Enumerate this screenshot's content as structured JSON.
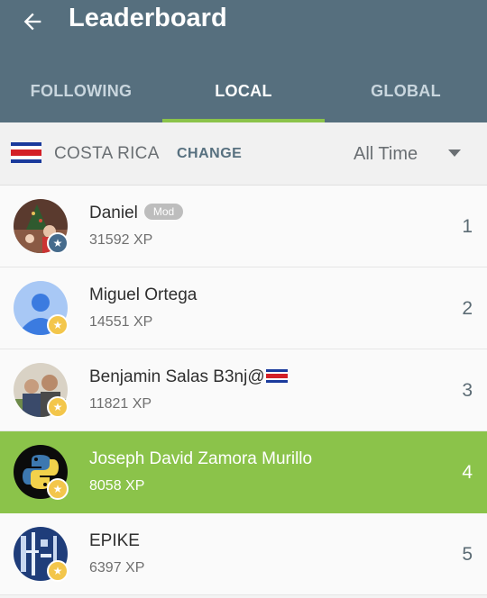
{
  "header": {
    "title": "Leaderboard",
    "back_icon": "arrow-left-icon"
  },
  "tabs": [
    {
      "label": "FOLLOWING",
      "active": false
    },
    {
      "label": "LOCAL",
      "active": true
    },
    {
      "label": "GLOBAL",
      "active": false
    }
  ],
  "filter": {
    "country": "COSTA RICA",
    "change_label": "CHANGE",
    "period": "All Time",
    "flag_icon": "costa-rica-flag-icon",
    "dropdown_icon": "caret-down-icon"
  },
  "entries": [
    {
      "name": "Daniel",
      "tag": "Mod",
      "xp": "31592 XP",
      "rank": "1",
      "badge": "mod-badge-icon"
    },
    {
      "name": "Miguel Ortega",
      "xp": "14551 XP",
      "rank": "2",
      "badge": "star-badge-icon"
    },
    {
      "name": "Benjamin Salas B3nj@",
      "name_suffix_icon": "costa-rica-flag-icon",
      "xp": "11821 XP",
      "rank": "3",
      "badge": "star-badge-icon"
    },
    {
      "name": "Joseph David Zamora Murillo",
      "xp": "8058 XP",
      "rank": "4",
      "badge": "star-badge-icon",
      "highlighted": true
    },
    {
      "name": "EPIKE",
      "xp": "6397 XP",
      "rank": "5",
      "badge": "star-badge-icon"
    }
  ],
  "colors": {
    "appbar": "#566f7e",
    "accent": "#8bc34a",
    "tab_inactive": "#c9d6de"
  }
}
